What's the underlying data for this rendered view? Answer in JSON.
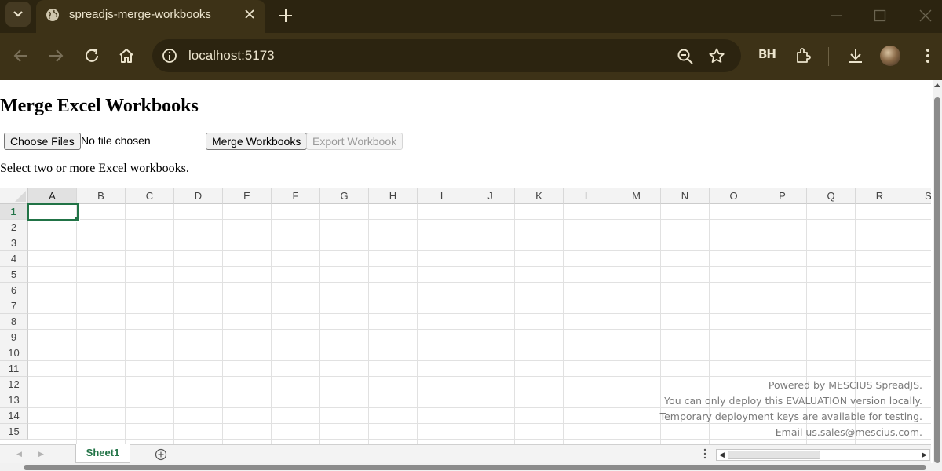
{
  "browser": {
    "tab_title": "spreadjs-merge-workbooks",
    "url": "localhost:5173",
    "extension_label": "BH",
    "icons": [
      "tab-search-icon",
      "globe-icon",
      "close-icon",
      "plus-icon",
      "minimize-icon",
      "maximize-icon",
      "window-close-icon",
      "back-icon",
      "forward-icon",
      "reload-icon",
      "home-icon",
      "site-info-icon",
      "zoom-out-icon",
      "star-icon",
      "extensions-icon",
      "download-icon",
      "kebab-menu-icon"
    ]
  },
  "page": {
    "title": "Merge Excel Workbooks",
    "choose_files_label": "Choose Files",
    "no_file_text": "No file chosen",
    "merge_label": "Merge Workbooks",
    "export_label": "Export Workbook",
    "instructions": "Select two or more Excel workbooks."
  },
  "spreadsheet": {
    "columns": [
      "A",
      "B",
      "C",
      "D",
      "E",
      "F",
      "G",
      "H",
      "I",
      "J",
      "K",
      "L",
      "M",
      "N",
      "O",
      "P",
      "Q",
      "R",
      "S"
    ],
    "rows": [
      "1",
      "2",
      "3",
      "4",
      "5",
      "6",
      "7",
      "8",
      "9",
      "10",
      "11",
      "12",
      "13",
      "14",
      "15"
    ],
    "active_cell": "A1",
    "watermark": [
      "Powered by MESCIUS SpreadJS.",
      "You can only deploy this EVALUATION version locally.",
      "Temporary deployment keys are available for testing.",
      "Email us.sales@mescius.com."
    ],
    "sheet_tab": "Sheet1",
    "accent_color": "#217346"
  }
}
